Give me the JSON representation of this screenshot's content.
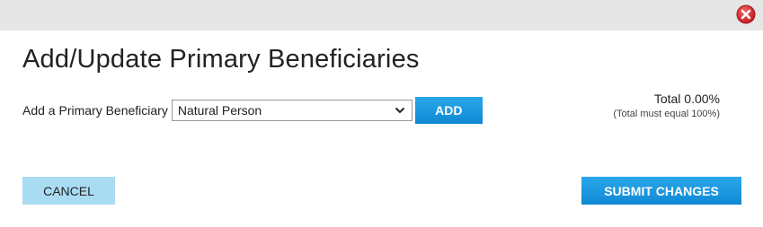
{
  "dialog": {
    "title": "Add/Update Primary Beneficiaries",
    "close_icon": "close-x-icon",
    "close_color": "#d9262c"
  },
  "add_beneficiary": {
    "label": "Add a Primary Beneficiary",
    "select_value": "Natural Person",
    "chevron_icon": "chevron-down-icon",
    "add_button_label": "ADD"
  },
  "total": {
    "text": "Total 0.00%",
    "hint": "(Total must equal 100%)"
  },
  "footer": {
    "cancel_label": "CANCEL",
    "submit_label": "SUBMIT CHANGES"
  },
  "colors": {
    "primary_button": "#1a9ae0",
    "secondary_button": "#a9dcf3",
    "titlebar": "#e6e6e6"
  }
}
